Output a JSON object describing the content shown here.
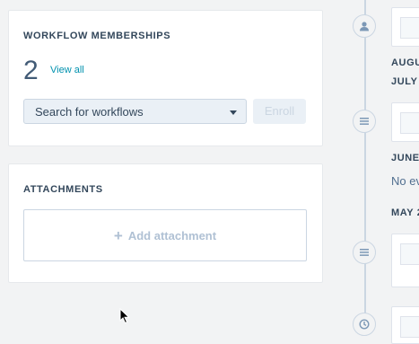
{
  "workflows": {
    "title": "WORKFLOW MEMBERSHIPS",
    "count": "2",
    "view_all": "View all",
    "search_placeholder": "Search for workflows",
    "enroll_label": "Enroll"
  },
  "attachments": {
    "title": "ATTACHMENTS",
    "add_label": "Add attachment"
  },
  "timeline": {
    "labels": [
      "AUGU",
      "JULY",
      "JUNE",
      "MAY 2"
    ],
    "no_events": "No ev",
    "icons": [
      "user-icon",
      "note-icon",
      "note-icon",
      "clock-icon"
    ]
  },
  "colors": {
    "accent": "#0091ae",
    "text": "#33475b",
    "border": "#cbd6e2"
  }
}
